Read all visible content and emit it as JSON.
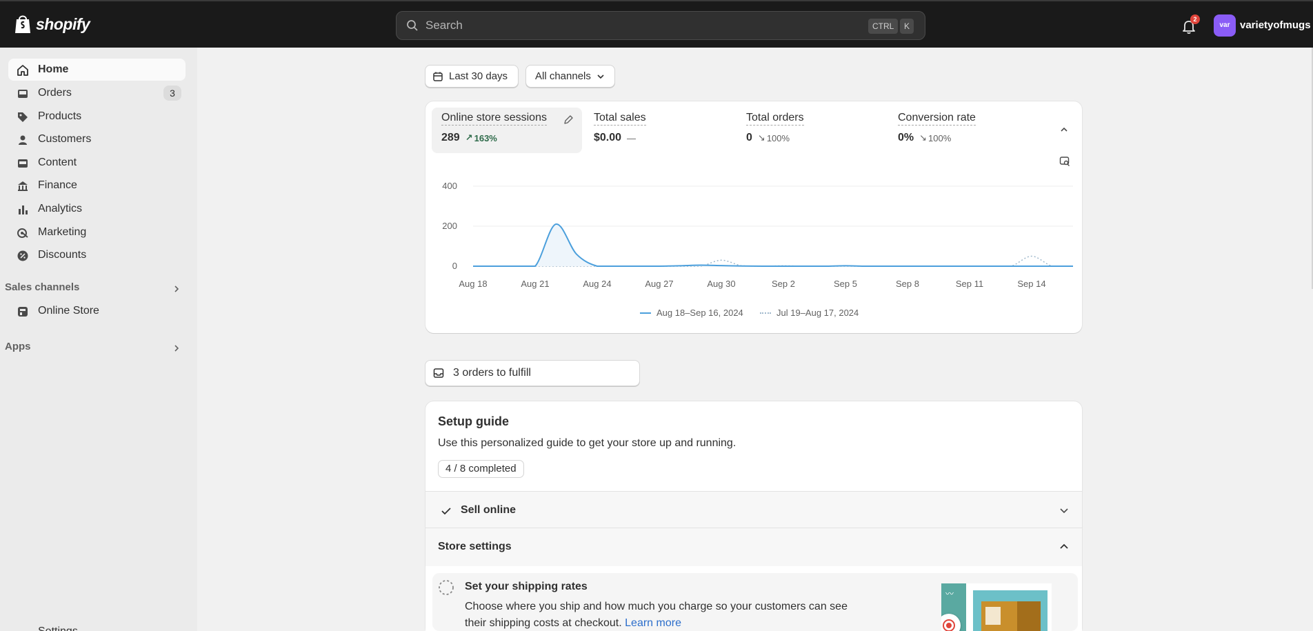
{
  "topbar": {
    "brand": "shopify",
    "search_placeholder": "Search",
    "shortcut_ctrl": "CTRL",
    "shortcut_key": "K",
    "notification_count": "2",
    "avatar_initials": "var",
    "store_name": "varietyofmugs"
  },
  "sidebar": {
    "items": [
      {
        "label": "Home",
        "icon": "home-icon"
      },
      {
        "label": "Orders",
        "icon": "inbox-icon",
        "badge": "3"
      },
      {
        "label": "Products",
        "icon": "tag-icon"
      },
      {
        "label": "Customers",
        "icon": "person-icon"
      },
      {
        "label": "Content",
        "icon": "image-icon"
      },
      {
        "label": "Finance",
        "icon": "bank-icon"
      },
      {
        "label": "Analytics",
        "icon": "bar-chart-icon"
      },
      {
        "label": "Marketing",
        "icon": "target-icon"
      },
      {
        "label": "Discounts",
        "icon": "discount-icon"
      }
    ],
    "sales_channels_label": "Sales channels",
    "online_store_label": "Online Store",
    "apps_label": "Apps",
    "settings_label": "Settings"
  },
  "filters": {
    "date_range": "Last 30 days",
    "channels": "All channels"
  },
  "metrics": [
    {
      "label": "Online store sessions",
      "value": "289",
      "change": "163%",
      "direction": "up"
    },
    {
      "label": "Total sales",
      "value": "$0.00",
      "change": "—",
      "direction": "none"
    },
    {
      "label": "Total orders",
      "value": "0",
      "change": "100%",
      "direction": "down"
    },
    {
      "label": "Conversion rate",
      "value": "0%",
      "change": "100%",
      "direction": "down"
    }
  ],
  "chart_data": {
    "type": "line",
    "x": [
      "Aug 18",
      "Aug 19",
      "Aug 20",
      "Aug 21",
      "Aug 22",
      "Aug 23",
      "Aug 24",
      "Aug 25",
      "Aug 26",
      "Aug 27",
      "Aug 28",
      "Aug 29",
      "Aug 30",
      "Aug 31",
      "Sep 1",
      "Sep 2",
      "Sep 3",
      "Sep 4",
      "Sep 5",
      "Sep 6",
      "Sep 7",
      "Sep 8",
      "Sep 9",
      "Sep 10",
      "Sep 11",
      "Sep 12",
      "Sep 13",
      "Sep 14",
      "Sep 15",
      "Sep 16"
    ],
    "tick_labels": [
      "Aug 18",
      "Aug 21",
      "Aug 24",
      "Aug 27",
      "Aug 30",
      "Sep 2",
      "Sep 5",
      "Sep 8",
      "Sep 11",
      "Sep 14"
    ],
    "yticks": [
      "400",
      "200",
      "0"
    ],
    "ylim": [
      0,
      400
    ],
    "series": [
      {
        "name": "Aug 18–Sep 16, 2024",
        "style": "solid",
        "color": "#4b9fdc",
        "values": [
          0,
          0,
          0,
          0,
          210,
          60,
          0,
          0,
          0,
          0,
          2,
          5,
          3,
          1,
          0,
          0,
          0,
          0,
          2,
          0,
          0,
          0,
          0,
          0,
          0,
          0,
          0,
          0,
          0,
          0
        ]
      },
      {
        "name": "Jul 19–Aug 17, 2024",
        "style": "dotted",
        "color": "#9fb8cc",
        "values": [
          0,
          0,
          0,
          0,
          0,
          0,
          0,
          0,
          0,
          0,
          0,
          0,
          30,
          2,
          0,
          2,
          0,
          0,
          0,
          0,
          0,
          0,
          0,
          0,
          0,
          0,
          0,
          50,
          0,
          0
        ]
      }
    ],
    "grid": true,
    "legend_position": "bottom"
  },
  "fulfill": {
    "label": "3 orders to fulfill"
  },
  "setup_guide": {
    "title": "Setup guide",
    "description": "Use this personalized guide to get your store up and running.",
    "progress": "4 / 8 completed",
    "sections": [
      {
        "label": "Sell online",
        "completed": true,
        "expanded": false
      },
      {
        "label": "Store settings",
        "completed": false,
        "expanded": true
      }
    ],
    "task": {
      "title": "Set your shipping rates",
      "description": "Choose where you ship and how much you charge so your customers can see their shipping costs at checkout.",
      "link": "Learn more"
    }
  }
}
